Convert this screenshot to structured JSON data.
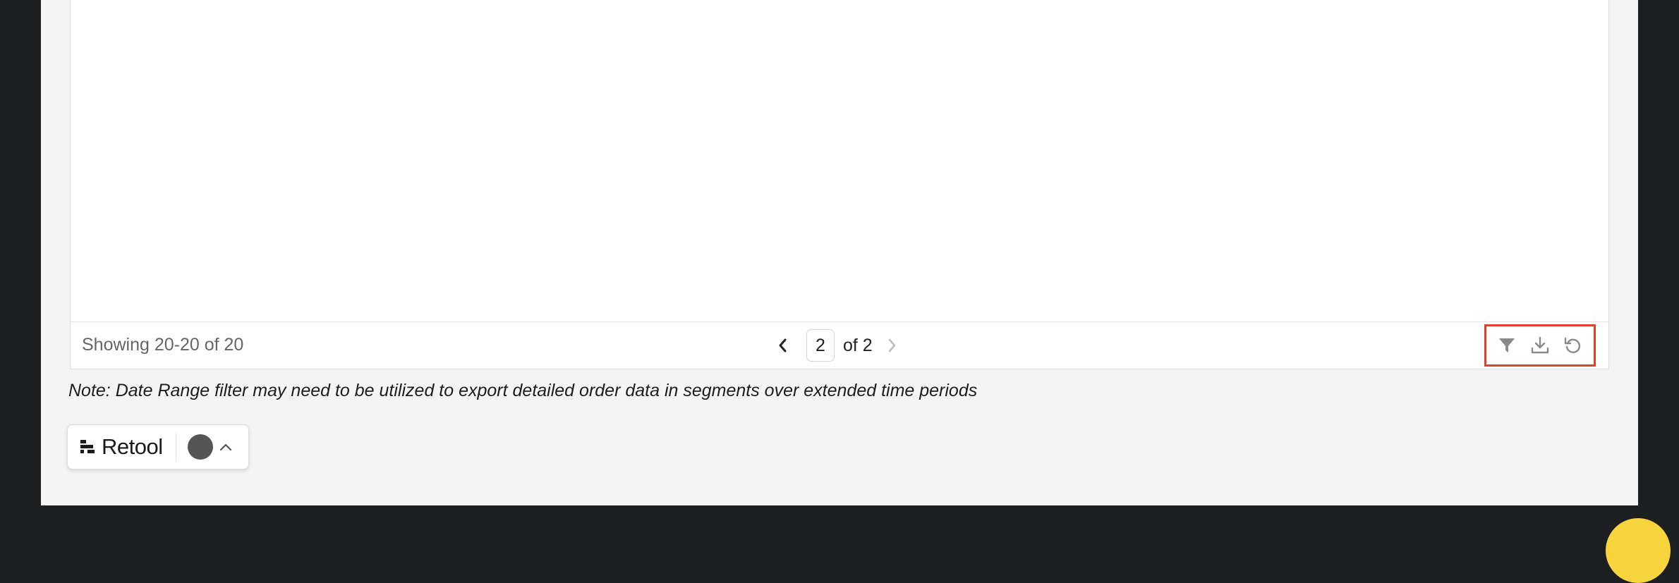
{
  "table": {
    "footer": {
      "showing_text": "Showing 20-20 of 20",
      "pagination": {
        "current_page": "2",
        "of_text": "of 2",
        "prev_icon": "chevron-left-icon",
        "next_icon": "chevron-right-icon"
      },
      "toolbar": {
        "filter_icon": "filter-icon",
        "download_icon": "download-icon",
        "refresh_icon": "refresh-icon",
        "highlight_color": "#e0412c"
      }
    }
  },
  "note": "Note: Date Range filter may need to be utilized to export detailed order data in segments over extended time periods",
  "retool_badge": {
    "name": "Retool",
    "logo_icon": "retool-logo-icon",
    "menu_icon": "chevron-up-icon"
  },
  "help_button": {
    "color": "#f7d43b"
  }
}
